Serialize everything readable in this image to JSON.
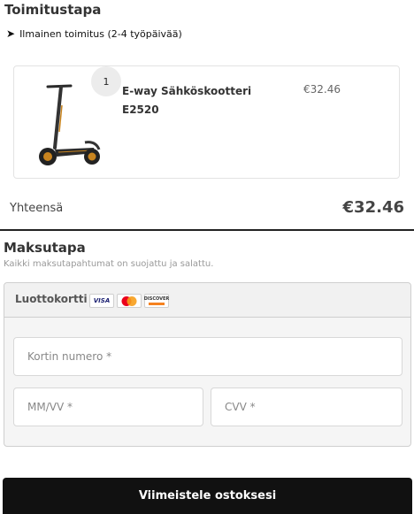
{
  "shipping": {
    "title": "Toimitustapa",
    "option_label": "Ilmainen toimitus (2-4 työpäivää)"
  },
  "cart": {
    "items": [
      {
        "quantity": "1",
        "name": "E-way Sähköskootteri E2520",
        "price": "€32.46",
        "image_icon": "electric-scooter"
      }
    ],
    "total_label": "Yhteensä",
    "total_value": "€32.46"
  },
  "payment": {
    "title": "Maksutapa",
    "description": "Kaikki maksutapahtumat on suojattu ja salattu.",
    "method_label": "Luottokortti",
    "card_brands": [
      "VISA",
      "MasterCard",
      "DISCOVER"
    ],
    "fields": {
      "card_number_placeholder": "Kortin numero *",
      "expiry_placeholder": "MM/VV *",
      "cvv_placeholder": "CVV *"
    }
  },
  "submit": {
    "label": "Viimeistele ostoksesi"
  },
  "colors": {
    "button_bg": "#111111",
    "panel_bg": "#f5f5f5",
    "divider": "#222222"
  }
}
